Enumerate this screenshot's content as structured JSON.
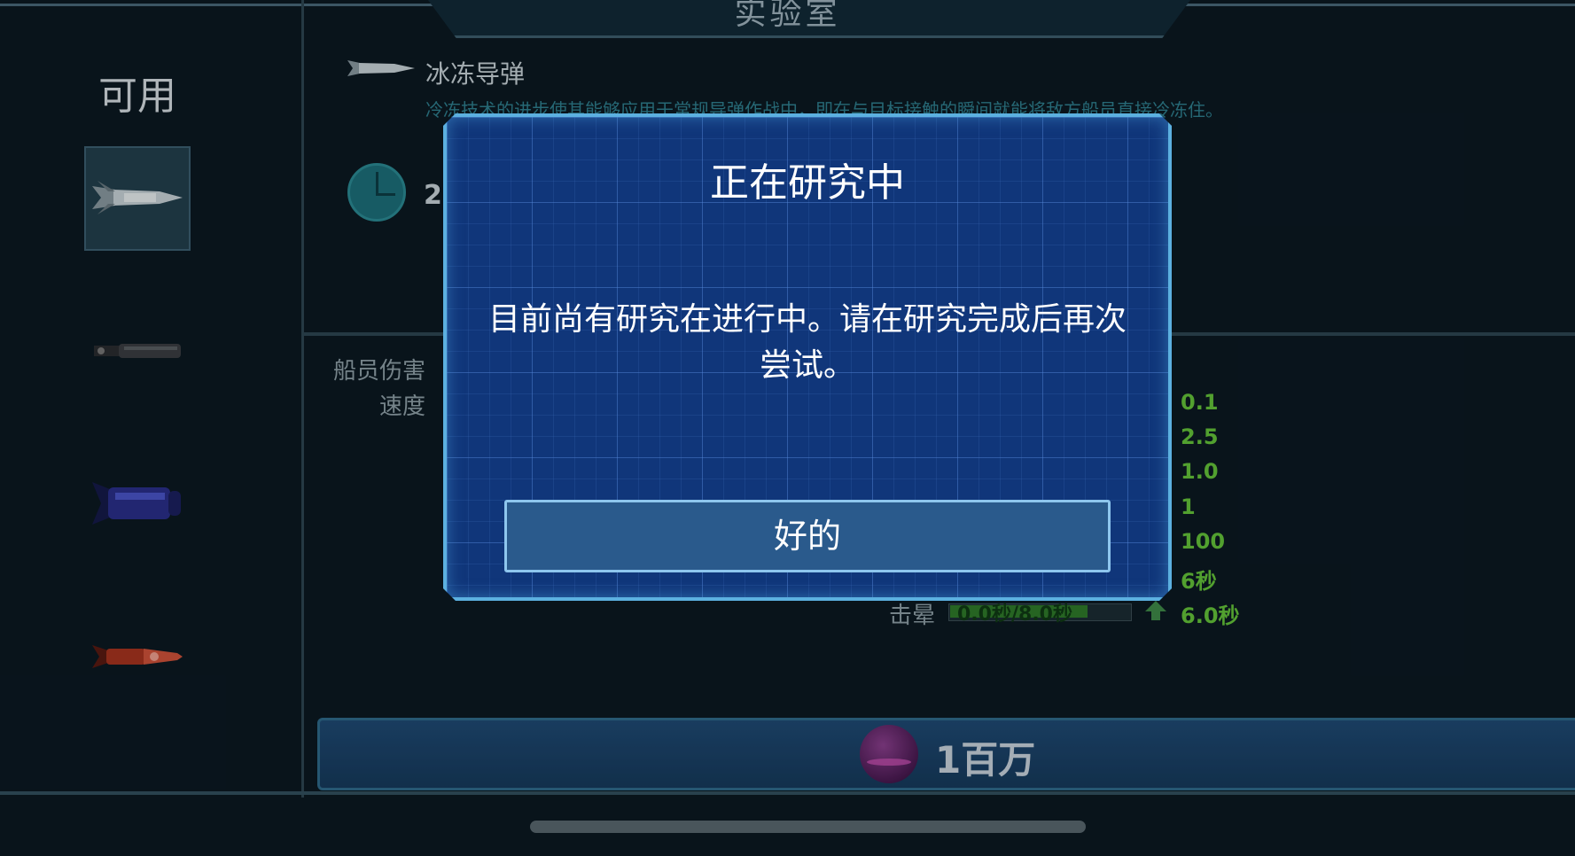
{
  "header": {
    "title": "实验室"
  },
  "left_panel": {
    "label": "可用",
    "missiles": [
      {
        "icon": "freeze-missile-icon",
        "selected": true
      },
      {
        "icon": "black-missile-icon",
        "selected": false
      },
      {
        "icon": "blue-missile-icon",
        "selected": false
      },
      {
        "icon": "red-missile-icon",
        "selected": false
      }
    ]
  },
  "missile": {
    "name": "冰冻导弹",
    "description": "冷冻技术的进步使其能够应用于常规导弹作战中，即在与目标接触的瞬间就能将敌方船员直接冷冻住。",
    "time_partial": "2"
  },
  "stats": {
    "labels": [
      "船员伤害",
      "速度"
    ],
    "values": [
      "0.1",
      "2.5",
      "1.0",
      "1",
      "100",
      "6秒"
    ],
    "stun_label": "击晕",
    "stun_bar_text": "0.0秒/8.0秒",
    "stun_value": "6.0秒"
  },
  "cost": {
    "amount": "1百万"
  },
  "modal": {
    "title": "正在研究中",
    "message_line1": "目前尚有研究在进行中。请在研究完成后再次",
    "message_line2": "尝试。",
    "ok_label": "好的"
  },
  "colors": {
    "accent_green": "#64c43a",
    "modal_bg": "#10367a",
    "modal_border": "#5cb0e0"
  }
}
